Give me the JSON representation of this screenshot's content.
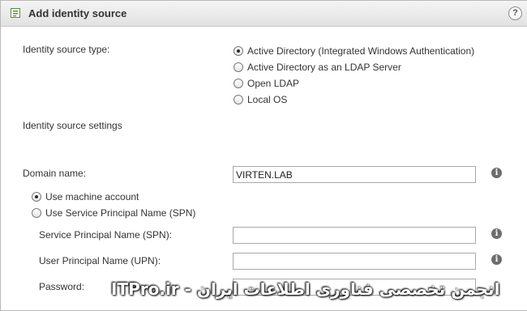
{
  "dialog": {
    "title": "Add identity source",
    "help_glyph": "?",
    "icon": "add-identity-source-icon"
  },
  "identity_source_type": {
    "label": "Identity source type:",
    "selected_index": 0,
    "options": [
      {
        "label": "Active Directory (Integrated Windows Authentication)",
        "selected": true
      },
      {
        "label": "Active Directory as an LDAP Server",
        "selected": false
      },
      {
        "label": "Open LDAP",
        "selected": false
      },
      {
        "label": "Local OS",
        "selected": false
      }
    ]
  },
  "settings": {
    "heading": "Identity source settings",
    "domain_name": {
      "label": "Domain name:",
      "value": "VIRTEN.LAB"
    },
    "account_options": [
      {
        "label": "Use machine account",
        "selected": true
      },
      {
        "label": "Use Service Principal Name (SPN)",
        "selected": false
      }
    ],
    "spn": {
      "label": "Service Principal Name (SPN):",
      "value": ""
    },
    "upn": {
      "label": "User Principal Name (UPN):",
      "value": ""
    },
    "password": {
      "label": "Password:",
      "value": ""
    }
  },
  "info_glyph": "i",
  "watermark": "ITPro.ir - انجمن تخصصی فناوری اطلاعات ایران",
  "colors": {
    "title_bar": "#e9e9e9",
    "border": "#b9b9b9",
    "info_icon": "#6d6d6d"
  }
}
